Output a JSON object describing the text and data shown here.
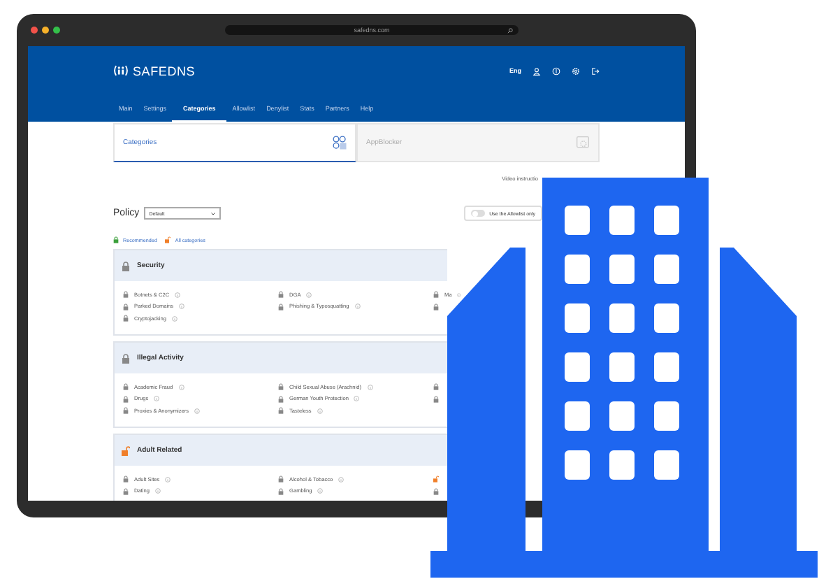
{
  "browser": {
    "address": "safedns.com"
  },
  "header": {
    "logo": "SAFEDNS",
    "language": "Eng"
  },
  "nav": [
    {
      "label": "Main",
      "selected": false
    },
    {
      "label": "Settings",
      "selected": false
    },
    {
      "label": "Categories",
      "selected": true
    },
    {
      "label": "Allowlist",
      "selected": false
    },
    {
      "label": "Denylist",
      "selected": false
    },
    {
      "label": "Stats",
      "selected": false
    },
    {
      "label": "Partners",
      "selected": false
    },
    {
      "label": "Help",
      "selected": false
    }
  ],
  "tabs": [
    {
      "label": "Categories",
      "selected": true
    },
    {
      "label": "AppBlocker",
      "selected": false
    }
  ],
  "video_link": "Video instructio",
  "policy": {
    "label": "Policy",
    "value": "Default"
  },
  "allowlist_toggle": {
    "label": "Use the Allowlist only",
    "on": false
  },
  "legend": [
    {
      "label": "Recommended",
      "kind": "recommended"
    },
    {
      "label": "All categories",
      "kind": "all"
    }
  ],
  "groups": [
    {
      "title": "Security",
      "locked": true,
      "items": [
        {
          "label": "Botnets & C2C",
          "locked": true
        },
        {
          "label": "DGA",
          "locked": true
        },
        {
          "label": "Ma",
          "locked": true
        },
        {
          "label": "Parked Domains",
          "locked": true
        },
        {
          "label": "Phishing & Typosquatting",
          "locked": true
        },
        {
          "locked": true
        },
        {
          "label": "Cryptojacking",
          "locked": true
        }
      ]
    },
    {
      "title": "Illegal Activity",
      "locked": true,
      "items": [
        {
          "label": "Academic Fraud",
          "locked": true
        },
        {
          "label": "Child Sexual Abuse (Arachnid)",
          "locked": true
        },
        {
          "locked": true
        },
        {
          "label": "Drugs",
          "locked": true
        },
        {
          "label": "German Youth Protection",
          "locked": true
        },
        {
          "locked": true
        },
        {
          "label": "Proxies & Anonymizers",
          "locked": true
        },
        {
          "label": "Tasteless",
          "locked": true
        }
      ]
    },
    {
      "title": "Adult Related",
      "locked": false,
      "items": [
        {
          "label": "Adult Sites",
          "locked": true
        },
        {
          "label": "Alcohol & Tobacco",
          "locked": true
        },
        {
          "locked": false
        },
        {
          "label": "Dating",
          "locked": true
        },
        {
          "label": "Gambling",
          "locked": true
        },
        {
          "locked": true
        }
      ]
    }
  ]
}
